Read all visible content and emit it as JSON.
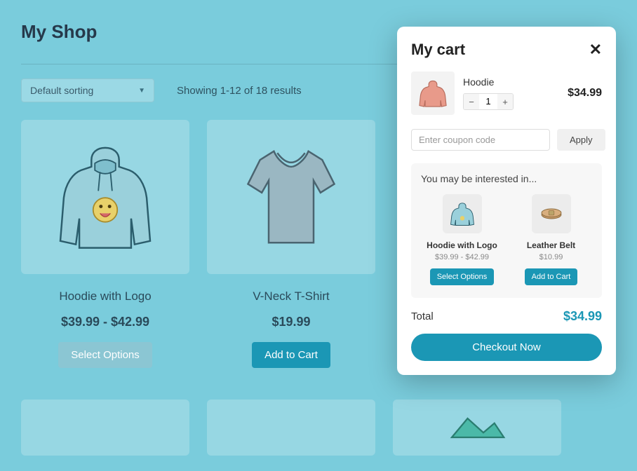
{
  "shop": {
    "title": "My Shop",
    "sort_label": "Default sorting",
    "results_text": "Showing 1-12 of 18 results",
    "products": [
      {
        "name": "Hoodie with Logo",
        "price": "$39.99 - $42.99",
        "button": "Select Options",
        "button_style": "muted"
      },
      {
        "name": "V-Neck T-Shirt",
        "price": "$19.99",
        "button": "Add to Cart",
        "button_style": "primary"
      }
    ]
  },
  "cart": {
    "title": "My cart",
    "item": {
      "name": "Hoodie",
      "qty": "1",
      "price": "$34.99"
    },
    "coupon_placeholder": "Enter coupon code",
    "apply_label": "Apply",
    "suggest": {
      "heading": "You may be interested in...",
      "items": [
        {
          "name": "Hoodie with Logo",
          "price": "$39.99 - $42.99",
          "button": "Select Options"
        },
        {
          "name": "Leather Belt",
          "price": "$10.99",
          "button": "Add to Cart"
        }
      ]
    },
    "total_label": "Total",
    "total_value": "$34.99",
    "checkout_label": "Checkout Now"
  }
}
